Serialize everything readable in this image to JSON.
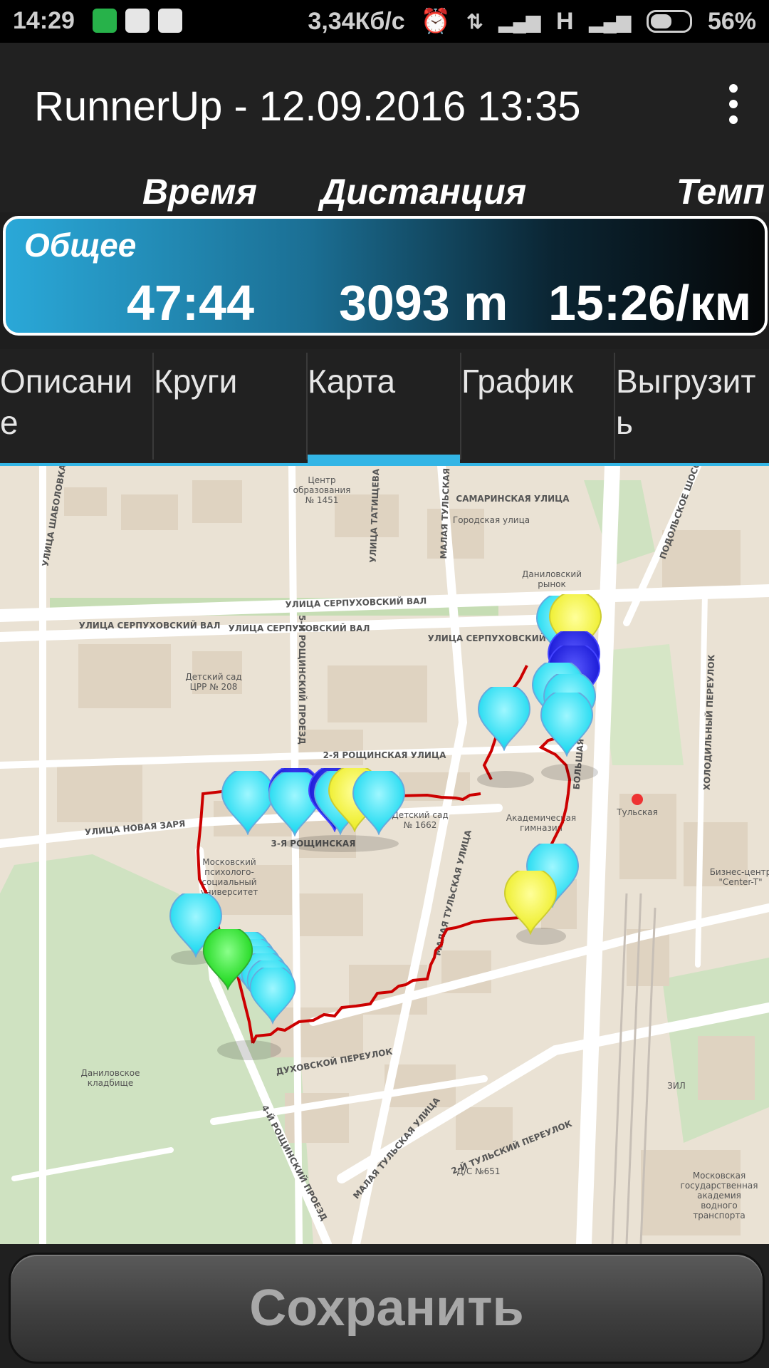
{
  "status_bar": {
    "time": "14:29",
    "network_speed": "3,34Кб/с",
    "network_type": "H",
    "battery_percent": "56%",
    "battery_level": 0.56,
    "icons": [
      "shield-icon",
      "mail-icon",
      "play-store-icon",
      "alarm-icon",
      "data-arrows-icon",
      "signal-icon",
      "signal-icon-2",
      "battery-icon"
    ]
  },
  "app_bar": {
    "title": "RunnerUp - 12.09.2016 13:35",
    "menu_icon": "overflow-menu-icon"
  },
  "summary": {
    "headers": {
      "time": "Время",
      "distance": "Дистанция",
      "pace": "Темп"
    },
    "row_label": "Общее",
    "time": "47:44",
    "distance": "3093 m",
    "pace": "15:26/км",
    "colors": {
      "gradient_start": "#2aa8d8",
      "gradient_end": "#050708"
    }
  },
  "tabs": [
    {
      "label": "Описание",
      "selected": false
    },
    {
      "label": "Круги",
      "selected": false
    },
    {
      "label": "Карта",
      "selected": true
    },
    {
      "label": "График",
      "selected": false
    },
    {
      "label": "Выгрузить",
      "selected": false
    }
  ],
  "accent_color": "#33b5e5",
  "map": {
    "labels": {
      "l1": "Центр",
      "l2": "образования",
      "l3": "№ 1451",
      "l4": "САМАРИНСКАЯ УЛИЦА",
      "l5": "Городская улица",
      "l6": "Даниловский",
      "l7": "рынок",
      "l8": "УЛИЦА СЕРПУХОВСКИЙ ВАЛ",
      "l9": "УЛИЦА СЕРПУХОВСКИЙ ВАЛ",
      "l10": "УЛИЦА СЕРПУХОВСКИЙ ВАЛ",
      "l11": "УЛИЦА СЕРПУХОВСКИЙ ВАЛ",
      "l12": "Детский сад",
      "l13": "ЦРР № 208",
      "l14": "5-Й РОЩИНСКИЙ ПРОЕЗД",
      "l15": "2-Я РОЩИНСКАЯ УЛИЦА",
      "l16": "Академическая",
      "l17": "гимназия",
      "l18": "Детский сад",
      "l19": "№ 1662",
      "l20": "УЛИЦА НОВАЯ ЗАРЯ",
      "l21": "3-Я РОЩИНСКАЯ",
      "l22": "Московский",
      "l23": "психолого-",
      "l24": "социальный",
      "l25": "университет",
      "l26": "МАЛАЯ ТУЛЬСКАЯ УЛИЦА",
      "l27": "Тульская",
      "l28": "Бизнес-центр",
      "l29": "\"Center-T\"",
      "l30": "ДУХОВСКОЙ ПЕРЕУЛОК",
      "l31": "Даниловское",
      "l32": "кладбище",
      "l33": "ЗИЛ",
      "l34": "2-Й ТУЛЬСКИЙ ПЕРЕУЛОК",
      "l35": "Д/С №651",
      "l36": "МАЛАЯ ТУЛЬСКАЯ УЛИЦА",
      "l37": "4-Й РОЩИНСКИЙ ПРОЕЗД",
      "l38": "Московская",
      "l39": "государственная",
      "l40": "академия",
      "l41": "водного",
      "l42": "транспорта",
      "l43": "УЛИЦА ШАБОЛОВКА",
      "l44": "УЛИЦА ТАТИЩЕВА",
      "l45": "ПОДОЛЬСКОЕ ШОССЕ",
      "l46": "ХОЛОДИЛЬНЫЙ ПЕРЕУЛОК",
      "l47": "БОЛЬШАЯ ТУЛЬСКАЯ",
      "l48": "МАЛАЯ ТУЛЬСКАЯ УЛИЦА"
    },
    "route_color": "#cc0000",
    "marker_colors": {
      "cyan": "#19e6f7",
      "yellow": "#f5f531",
      "blue": "#1a1ae6",
      "green": "#1fe01f"
    }
  },
  "save_button": {
    "label": "Сохранить"
  }
}
